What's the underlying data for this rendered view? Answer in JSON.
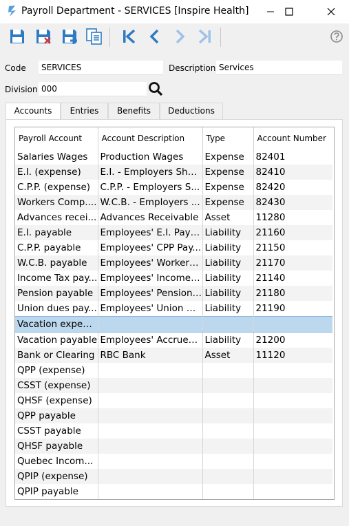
{
  "window": {
    "title": "Payroll Department - SERVICES [Inspire Health]"
  },
  "toolbar": {
    "buttons": [
      "save-icon",
      "save-delete-icon",
      "save-new-icon",
      "copy-icon",
      "first-record-icon",
      "previous-record-icon",
      "next-record-icon",
      "last-record-icon",
      "help-icon"
    ]
  },
  "form": {
    "code_label": "Code",
    "code_value": "SERVICES",
    "description_label": "Description",
    "description_value": "Services",
    "division_label": "Division",
    "division_value": "000"
  },
  "tabs": [
    "Accounts",
    "Entries",
    "Benefits",
    "Deductions"
  ],
  "active_tab": "Accounts",
  "table": {
    "columns": [
      "Payroll Account",
      "Account Description",
      "Type",
      "Account Number"
    ],
    "rows": [
      [
        "Salaries Wages",
        "Production Wages",
        "Expense",
        "82401"
      ],
      [
        "E.I. (expense)",
        "E.I. - Employers Share",
        "Expense",
        "82410"
      ],
      [
        "C.P.P. (expense)",
        "C.P.P. - Employers S...",
        "Expense",
        "82420"
      ],
      [
        "Workers Comp....",
        "W.C.B. - Employers ...",
        "Expense",
        "82430"
      ],
      [
        "Advances recei...",
        "Advances Receivable",
        "Asset",
        "11280"
      ],
      [
        "E.I. payable",
        "Employees' E.I. Paya...",
        "Liability",
        "21160"
      ],
      [
        "C.P.P. payable",
        "Employees' CPP Pay...",
        "Liability",
        "21150"
      ],
      [
        "W.C.B. payable",
        "Employees' Workers...",
        "Liability",
        "21170"
      ],
      [
        "Income Tax pay...",
        "Employees' Income ...",
        "Liability",
        "21140"
      ],
      [
        "Pension payable",
        "Employees' Pension ...",
        "Liability",
        "21180"
      ],
      [
        "Union dues pay...",
        "Employees' Union D...",
        "Liability",
        "21190"
      ],
      [
        "Vacation expen...",
        "",
        "",
        ""
      ],
      [
        "Vacation payable",
        "Employees' Accrued...",
        "Liability",
        "21200"
      ],
      [
        "Bank or Clearing",
        "RBC Bank",
        "Asset",
        "11120"
      ],
      [
        "QPP (expense)",
        "",
        "",
        ""
      ],
      [
        "CSST (expense)",
        "",
        "",
        ""
      ],
      [
        "QHSF (expense)",
        "",
        "",
        ""
      ],
      [
        "QPP payable",
        "",
        "",
        ""
      ],
      [
        "CSST payable",
        "",
        "",
        ""
      ],
      [
        "QHSF payable",
        "",
        "",
        ""
      ],
      [
        "Quebec Incom...",
        "",
        "",
        ""
      ],
      [
        "QPIP (expense)",
        "",
        "",
        ""
      ],
      [
        "QPIP payable",
        "",
        "",
        ""
      ]
    ],
    "selected_row": 11
  },
  "colors": {
    "accent": "#2e7bc4",
    "selected_row": "#bcd8ee"
  }
}
